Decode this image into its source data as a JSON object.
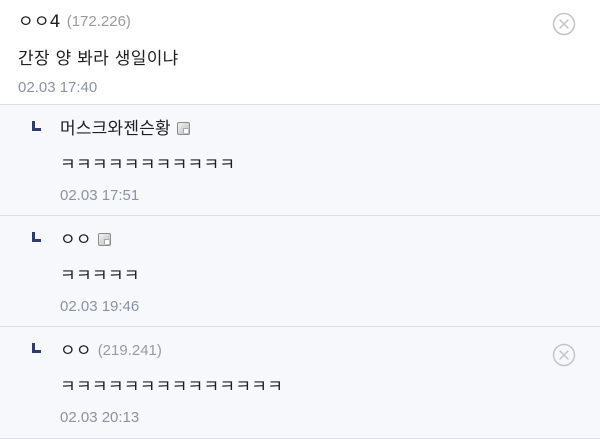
{
  "comments": [
    {
      "nickname": "ㅇㅇ4",
      "ip": "(172.226)",
      "body": "간장 양 봐라 생일이냐",
      "time": "02.03 17:40",
      "has_delete": true,
      "has_gallog": false,
      "is_reply": false
    },
    {
      "nickname": "머스크와젠슨황",
      "ip": "",
      "body": "ㅋㅋㅋㅋㅋㅋㅋㅋㅋㅋㅋ",
      "time": "02.03 17:51",
      "has_delete": false,
      "has_gallog": true,
      "is_reply": true
    },
    {
      "nickname": "ㅇㅇ",
      "ip": "",
      "body": "ㅋㅋㅋㅋㅋ",
      "time": "02.03 19:46",
      "has_delete": false,
      "has_gallog": true,
      "is_reply": true
    },
    {
      "nickname": "ㅇㅇ",
      "ip": "(219.241)",
      "body": "ㅋㅋㅋㅋㅋㅋㅋㅋㅋㅋㅋㅋㅋㅋ",
      "time": "02.03 20:13",
      "has_delete": true,
      "has_gallog": false,
      "is_reply": true
    }
  ],
  "icons": {
    "reply": "reply-arrow-icon",
    "delete": "delete-circle-x-icon",
    "gallog": "gallog-icon"
  },
  "colors": {
    "reply_arrow": "#2f3a73",
    "reply_background": "#f7f8fb",
    "timestamp": "#8a92a8",
    "divider": "#dcdfe7"
  }
}
